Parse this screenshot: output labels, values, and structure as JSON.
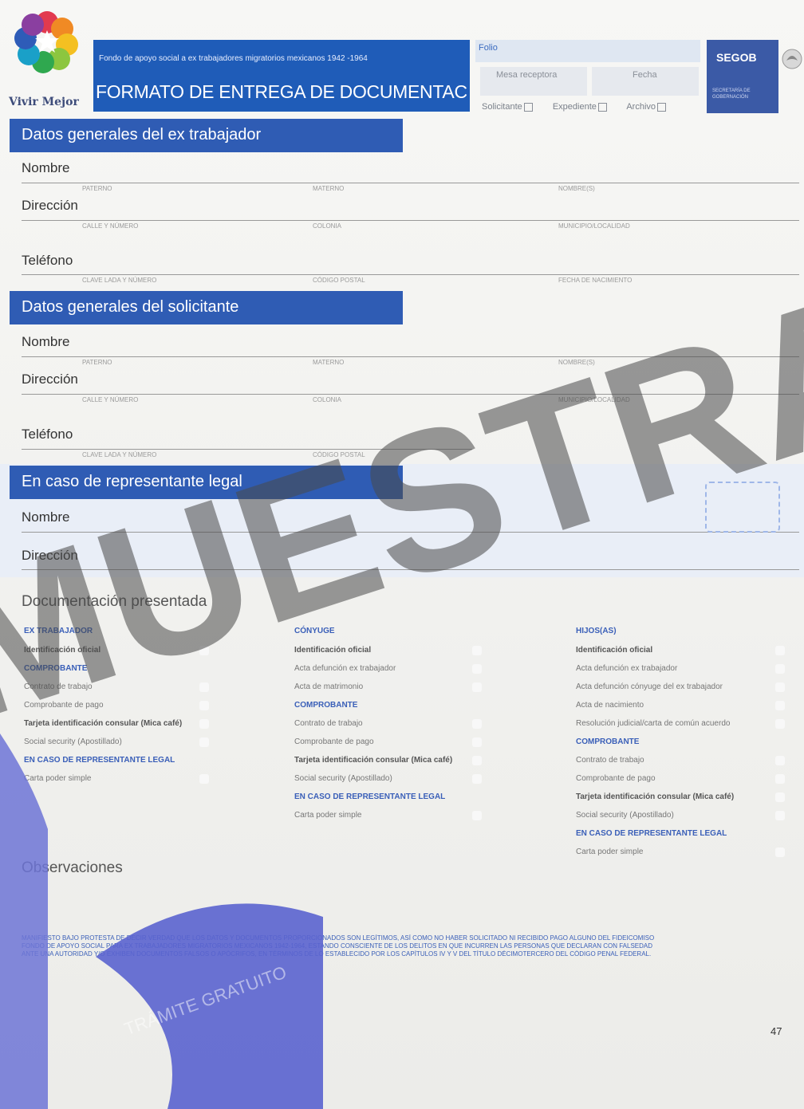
{
  "header": {
    "brand": "Vivir Mejor",
    "subtitle": "Fondo de apoyo social a ex trabajadores migratorios mexicanos 1942 -1964",
    "title": "FORMATO DE ENTREGA DE DOCUMENTACIÓN",
    "folio_label": "Folio",
    "mesa_label": "Mesa receptora",
    "fecha_label": "Fecha",
    "checks": [
      "Solicitante",
      "Expediente",
      "Archivo"
    ],
    "segob": "SEGOB",
    "segob_sub": "SECRETARÍA DE GOBERNACIÓN"
  },
  "sections": {
    "trabajador": "Datos generales del ex trabajador",
    "solicitante": "Datos generales del solicitante",
    "representante": "En caso de representante legal"
  },
  "fields": {
    "nombre": "Nombre",
    "direccion": "Dirección",
    "telefono": "Teléfono",
    "sub_nombre": [
      "PATERNO",
      "MATERNO",
      "NOMBRE(S)"
    ],
    "sub_direccion": [
      "CALLE Y NÚMERO",
      "COLONIA",
      "MUNICIPIO/LOCALIDAD"
    ],
    "sub_telefono": [
      "CLAVE LADA Y NÚMERO",
      "CÓDIGO POSTAL",
      "FECHA DE NACIMIENTO"
    ],
    "sub_telefono2": [
      "CLAVE LADA Y NÚMERO",
      "CÓDIGO POSTAL"
    ]
  },
  "documentacion": {
    "title": "Documentación presentada",
    "col1": {
      "h1": "EX TRABAJADOR",
      "i1": "Identificación oficial",
      "h2": "COMPROBANTE",
      "i2": "Contrato de trabajo",
      "i3": "Comprobante de pago",
      "i4": "Tarjeta identificación consular (Mica café)",
      "i5": "Social security (Apostillado)",
      "h3": "EN CASO DE REPRESENTANTE LEGAL",
      "i6": "Carta poder simple"
    },
    "col2": {
      "h1": "CÓNYUGE",
      "i1": "Identificación oficial",
      "i2": "Acta defunción ex trabajador",
      "i3": "Acta de matrimonio",
      "h2": "COMPROBANTE",
      "i4": "Contrato de trabajo",
      "i5": "Comprobante de pago",
      "i6": "Tarjeta identificación consular (Mica café)",
      "i7": "Social security (Apostillado)",
      "h3": "EN CASO DE REPRESENTANTE LEGAL",
      "i8": "Carta poder simple"
    },
    "col3": {
      "h1": "HIJOS(AS)",
      "i1": "Identificación oficial",
      "i2": "Acta defunción ex trabajador",
      "i3": "Acta defunción cónyuge del ex trabajador",
      "i4": "Acta de nacimiento",
      "i5": "Resolución judicial/carta de común acuerdo",
      "h2": "COMPROBANTE",
      "i6": "Contrato de trabajo",
      "i7": "Comprobante de pago",
      "i8": "Tarjeta identificación consular (Mica café)",
      "i9": "Social security (Apostillado)",
      "h3": "EN CASO DE REPRESENTANTE LEGAL",
      "i10": "Carta poder simple"
    }
  },
  "observaciones": "Observaciones",
  "legal": [
    "MANIFIESTO BAJO PROTESTA DE DECIR VERDAD QUE LOS DATOS Y DOCUMENTOS PROPORCIONADOS SON LEGÍTIMOS, ASÍ COMO NO HABER SOLICITADO NI RECIBIDO PAGO ALGUNO DEL FIDEICOMISO",
    "FONDO DE APOYO SOCIAL PARA EX TRABAJADORES MIGRATORIOS MEXICANOS 1942-1964, ESTANDO CONSCIENTE DE LOS DELITOS EN QUE INCURREN LAS PERSONAS QUE DECLARAN CON FALSEDAD",
    "ANTE UNA AUTORIDAD Y/O EXHIBEN DOCUMENTOS FALSOS O APÓCRIFOS, EN TÉRMINOS DE LO ESTABLECIDO POR LOS CAPÍTULOS IV Y V DEL TÍTULO DÉCIMOTERCERO DEL CÓDIGO PENAL FEDERAL."
  ],
  "page_number": "47",
  "watermark": "MUESTRA",
  "watermark_repeat": "TRÁMITE GRATUITO"
}
